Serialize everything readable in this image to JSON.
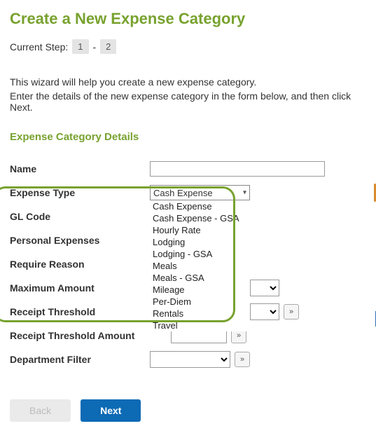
{
  "title": "Create a New Expense Category",
  "steps": {
    "label": "Current Step:",
    "s1": "1",
    "sep": "-",
    "s2": "2"
  },
  "intro": {
    "line1": "This wizard will help you create a new expense category.",
    "line2": "Enter the details of the new expense category in the form below, and then click Next."
  },
  "section": "Expense Category Details",
  "labels": {
    "name": "Name",
    "expense_type": "Expense Type",
    "gl_code": "GL Code",
    "personal": "Personal Expenses",
    "reason": "Require Reason",
    "max_amount": "Maximum Amount",
    "receipt_threshold": "Receipt Threshold",
    "receipt_amount": "Receipt Threshold Amount",
    "dept_filter": "Department Filter"
  },
  "expense_type": {
    "selected": "Cash Expense",
    "options": [
      "Cash Expense",
      "Cash Expense - GSA",
      "Hourly Rate",
      "Lodging",
      "Lodging - GSA",
      "Meals",
      "Meals - GSA",
      "Mileage",
      "Per-Diem",
      "Rentals",
      "Travel"
    ]
  },
  "values": {
    "name": "",
    "gl_code": "",
    "max_amount": "",
    "receipt_threshold": "",
    "receipt_amount": "",
    "dept_filter": ""
  },
  "more_glyph": "»",
  "buttons": {
    "back": "Back",
    "next": "Next"
  }
}
